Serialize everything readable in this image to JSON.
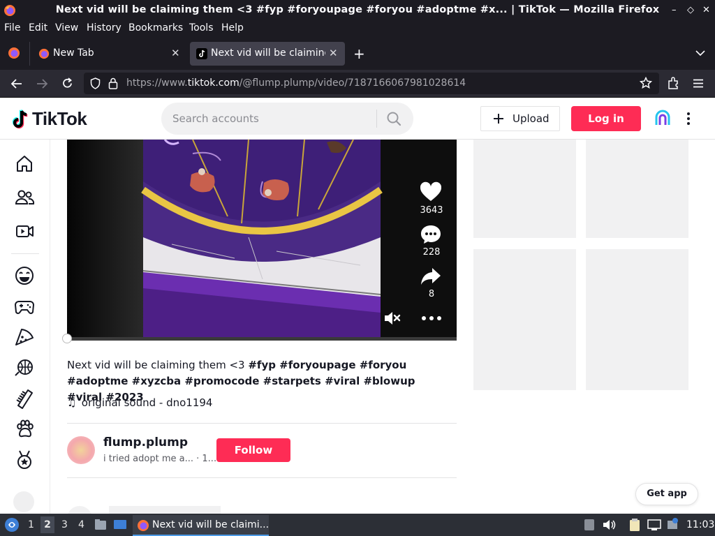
{
  "window": {
    "title": "Next vid will be claiming them <3 #fyp #foryoupage #foryou #adoptme #x... | TikTok — Mozilla Firefox",
    "controls": [
      "–",
      "◇",
      "✕"
    ]
  },
  "menu": [
    "File",
    "Edit",
    "View",
    "History",
    "Bookmarks",
    "Tools",
    "Help"
  ],
  "tabs": [
    {
      "label": "New Tab"
    },
    {
      "label": "Next vid will be claiming"
    }
  ],
  "address": {
    "prefix": "https://www.",
    "domain": "tiktok.com",
    "path": "/@flump.plump/video/7187166067981028614"
  },
  "tiktok": {
    "logo_text": "TikTok",
    "search_placeholder": "Search accounts",
    "upload_label": "Upload",
    "login_label": "Log in",
    "actions": {
      "likes": "3643",
      "comments": "228",
      "shares": "8"
    },
    "description_text": "Next vid will be claiming them <3 ",
    "description_tags": "#fyp #foryoupage #foryou #adoptme #xyzcba #promocode #starpets #viral #blowup #viral #2023",
    "sound": "original sound - dno1194",
    "author": {
      "username": "flump.plump",
      "bio": "i tried adopt me a...",
      "time": "· 1..."
    },
    "follow_label": "Follow",
    "get_app_label": "Get app",
    "video_progress": 0
  },
  "taskbar": {
    "workspaces": [
      "1",
      "2",
      "3",
      "4"
    ],
    "active_workspace": "2",
    "task_label": "Next vid will be claimi...",
    "clock": "11:03"
  },
  "colors": {
    "brand": "#fe2c55",
    "browser_dark": "#1c1b22",
    "text_primary": "#161823"
  }
}
